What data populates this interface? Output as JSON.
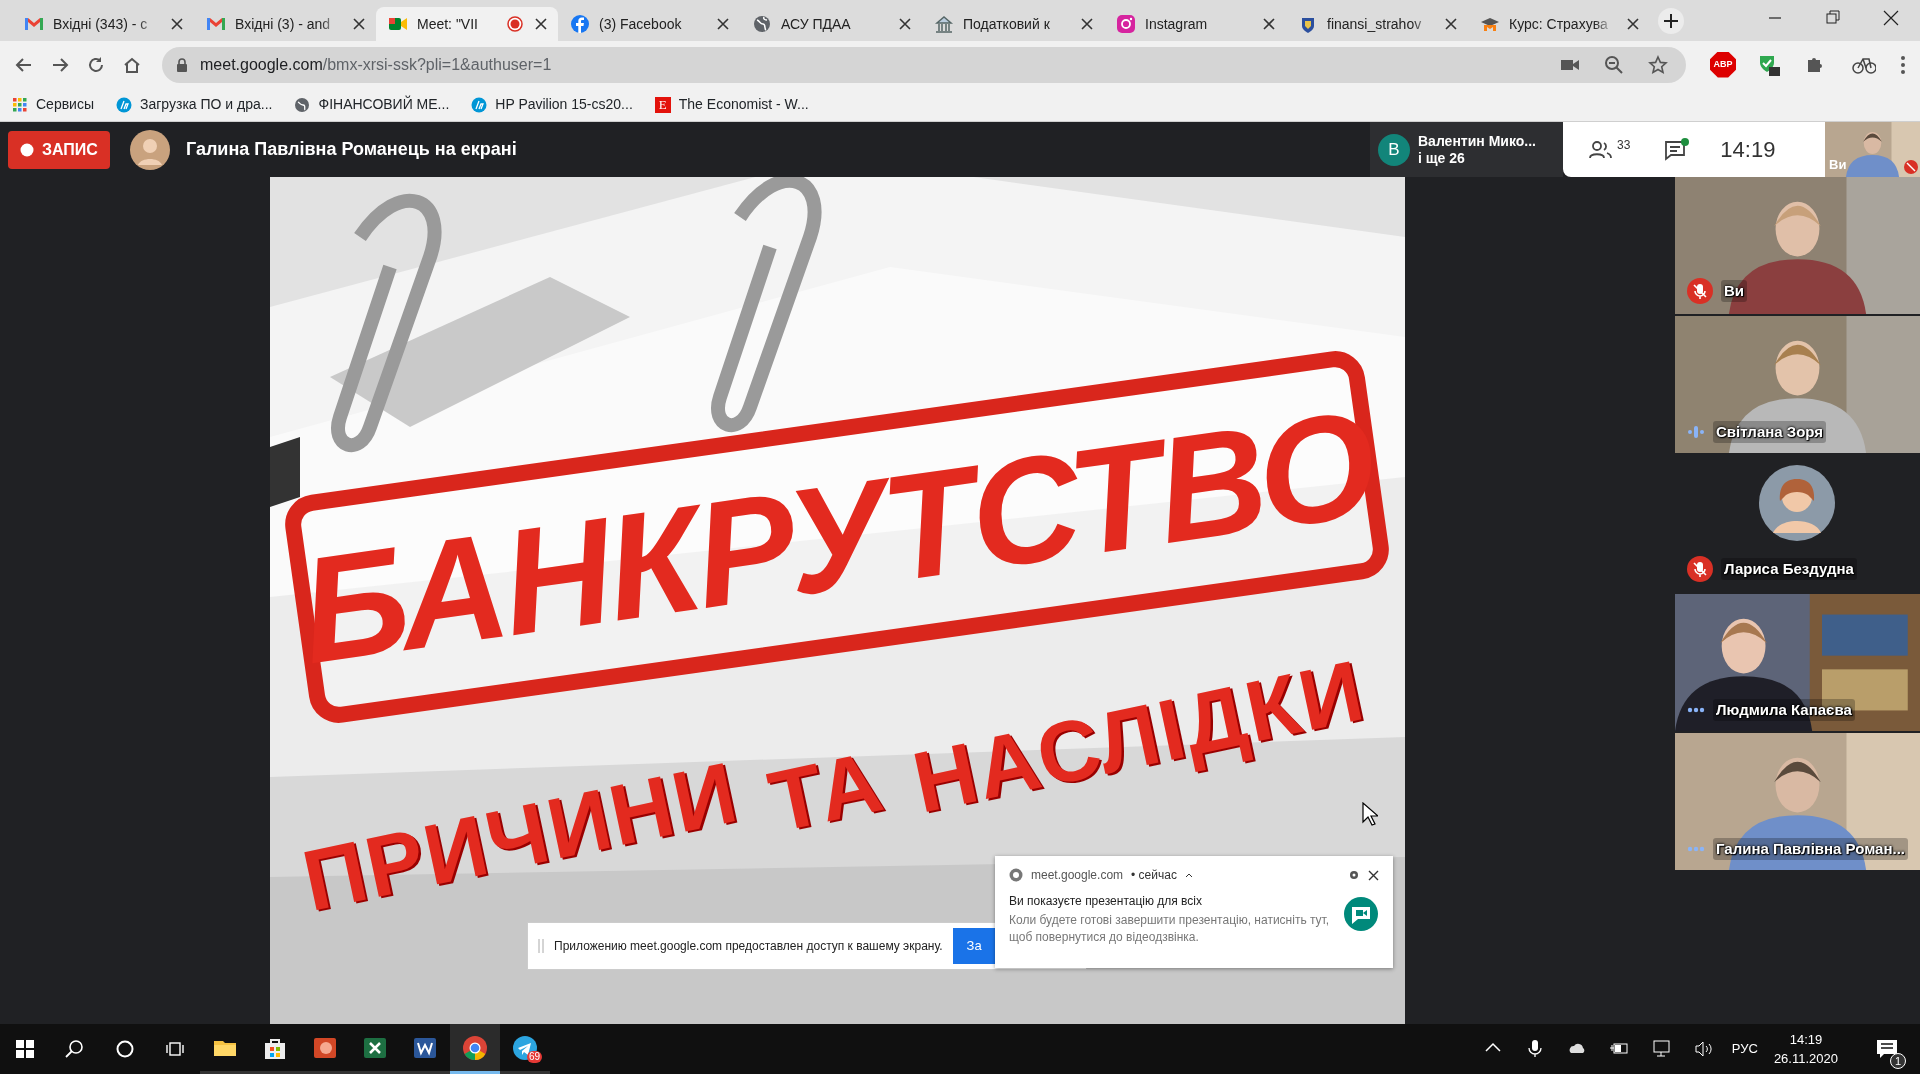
{
  "browser": {
    "tabs": [
      {
        "title": "Вхідні (343) - с",
        "selected": false,
        "recording": false
      },
      {
        "title": "Вхідні (3) - and",
        "selected": false,
        "recording": false
      },
      {
        "title": "Meet: \"VII",
        "selected": true,
        "recording": true
      },
      {
        "title": "(3) Facebook",
        "selected": false,
        "recording": false
      },
      {
        "title": "АСУ ПДАА",
        "selected": false,
        "recording": false
      },
      {
        "title": "Податковий к",
        "selected": false,
        "recording": false
      },
      {
        "title": "Instagram",
        "selected": false,
        "recording": false
      },
      {
        "title": "finansi_strahov",
        "selected": false,
        "recording": false
      },
      {
        "title": "Курс: Страхува",
        "selected": false,
        "recording": false
      }
    ],
    "url_host": "meet.google.com",
    "url_path": "/bmx-xrsi-ssk?pli=1&authuser=1",
    "adblock_label": "ABP",
    "bookmarks": [
      {
        "label": "Сервисы"
      },
      {
        "label": "Загрузка ПО и дра..."
      },
      {
        "label": "ФІНАНСОВИЙ МЕ..."
      },
      {
        "label": "HP Pavilion 15-cs20..."
      },
      {
        "label": "The Economist - W...",
        "letter": "E"
      }
    ]
  },
  "meet": {
    "record_label": "ЗАПИС",
    "presenter": "Галина Павлівна Романець на екрані",
    "participants": {
      "letter": "В",
      "name": "Валентин Мико...",
      "more": "і ще 26"
    },
    "people_count": "33",
    "chat_unread": true,
    "time": "14:19",
    "self_label": "Ви",
    "slide": {
      "title": "БАНКРУТСТВО",
      "subtitle": [
        "ПРИЧИНИ",
        "ТА",
        "НАСЛІДКИ"
      ]
    },
    "share_bar": {
      "text": "Приложению meet.google.com предоставлен доступ к вашему экрану.",
      "button": "За"
    },
    "notification": {
      "source": "meet.google.com",
      "when": "• сейчас",
      "title": "Ви показуєте презентацію для всіх",
      "body": "Коли будете готові завершити презентацію, натисніть тут, щоб повернутися до відеодзвінка."
    },
    "tiles": [
      {
        "name": "Ви",
        "kind": "video",
        "muted": true
      },
      {
        "name": "Світлана Зоря",
        "kind": "video",
        "muted": false,
        "speaking": true
      },
      {
        "name": "Лариса Бездудна",
        "kind": "avatar",
        "muted": true
      },
      {
        "name": "Людмила Капаєва",
        "kind": "video",
        "muted": false,
        "speaking": false
      },
      {
        "name": "Галина Павлівна Роман...",
        "kind": "video",
        "muted": false,
        "speaking": false
      }
    ]
  },
  "taskbar": {
    "apps": [
      {
        "active": false
      },
      {
        "active": false
      },
      {
        "active": false
      },
      {
        "active": false
      },
      {
        "active": false
      },
      {
        "active": true
      },
      {
        "active": false,
        "badge": "69"
      }
    ],
    "language": "РУС",
    "time": "14:19",
    "date": "26.11.2020",
    "notifications": "1"
  }
}
